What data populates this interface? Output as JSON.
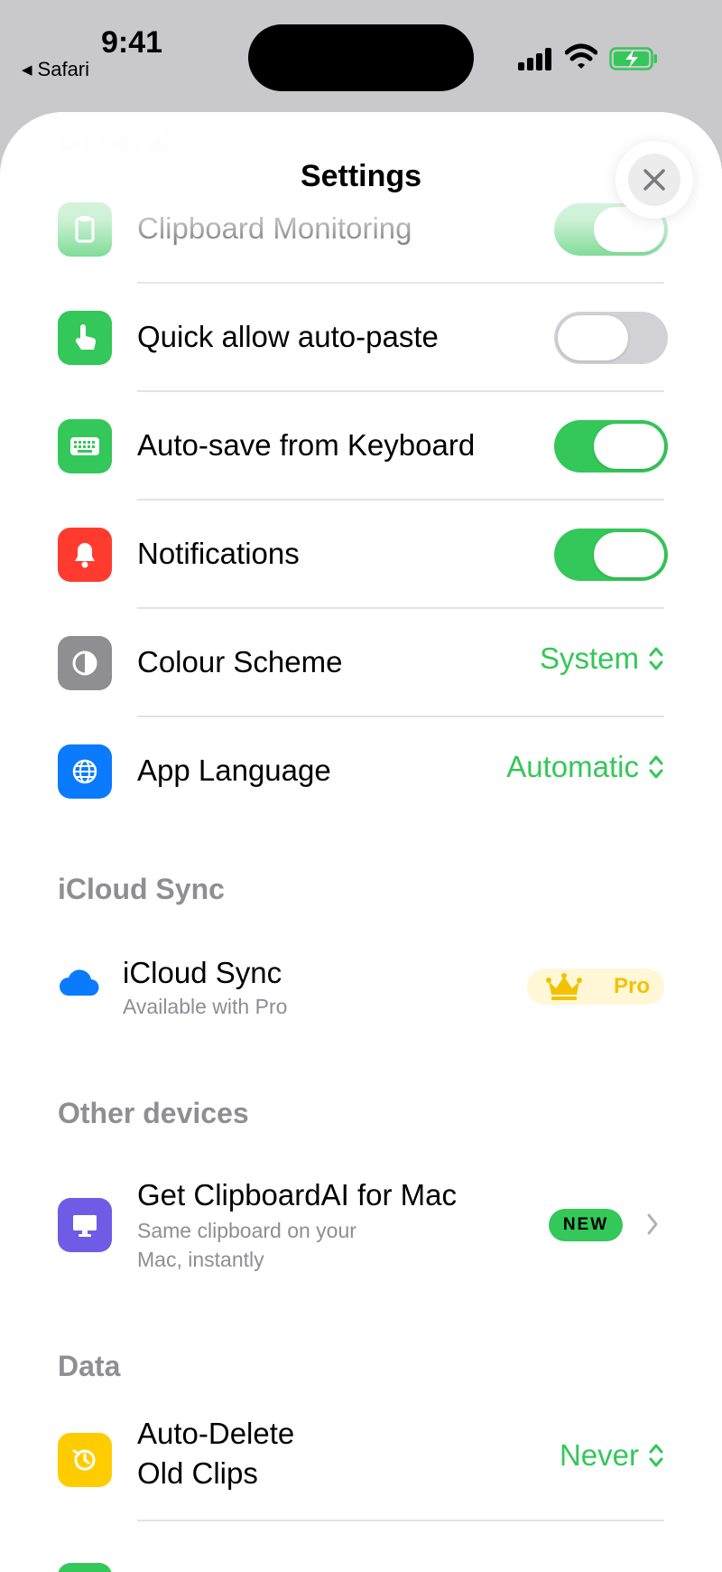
{
  "status_bar": {
    "time": "9:41",
    "back_app": "Safari",
    "back_glyph": "◀"
  },
  "sheet": {
    "title": "Settings",
    "ghost_header": "General",
    "close_icon": "xmark-icon"
  },
  "general": {
    "rows": [
      {
        "label": "Clipboard Monitoring",
        "icon": "clipboard-icon",
        "icon_color": "#34c759",
        "control": "toggle",
        "on": true
      },
      {
        "label": "Quick allow auto-paste",
        "icon": "hand-tap-icon",
        "icon_color": "#34c759",
        "control": "toggle",
        "on": false
      },
      {
        "label": "Auto-save from Keyboard",
        "icon": "keyboard-icon",
        "icon_color": "#34c759",
        "control": "toggle",
        "on": true
      },
      {
        "label": "Notifications",
        "icon": "bell-icon",
        "icon_color": "#ff3b30",
        "control": "toggle",
        "on": true
      },
      {
        "label": "Colour Scheme",
        "icon": "circle-half-icon",
        "icon_color": "#8e8e93",
        "control": "picker",
        "value": "System"
      },
      {
        "label": "App Language",
        "icon": "globe-icon",
        "icon_color": "#0a7aff",
        "control": "picker",
        "value": "Automatic"
      }
    ]
  },
  "icloud": {
    "header": "iCloud Sync",
    "title": "iCloud Sync",
    "subtitle": "Available with Pro",
    "badge": "Pro",
    "icon": "cloud-icon",
    "icon_color": "#0a7aff"
  },
  "other_devices": {
    "header": "Other devices",
    "title": "Get ClipboardAI for Mac",
    "subtitle_line1": "Same clipboard on your",
    "subtitle_line2": "Mac, instantly",
    "badge": "NEW",
    "icon": "desktop-icon",
    "icon_color": "#6e5ce6"
  },
  "data_section": {
    "header": "Data",
    "row_label_line1": "Auto-Delete",
    "row_label_line2": "Old Clips",
    "value": "Never",
    "icon": "clock-history-icon",
    "icon_color": "#ffcc00"
  },
  "colors": {
    "accent": "#34c759",
    "secondary_text": "#8e8e93",
    "pro_gold": "#f2c200"
  }
}
